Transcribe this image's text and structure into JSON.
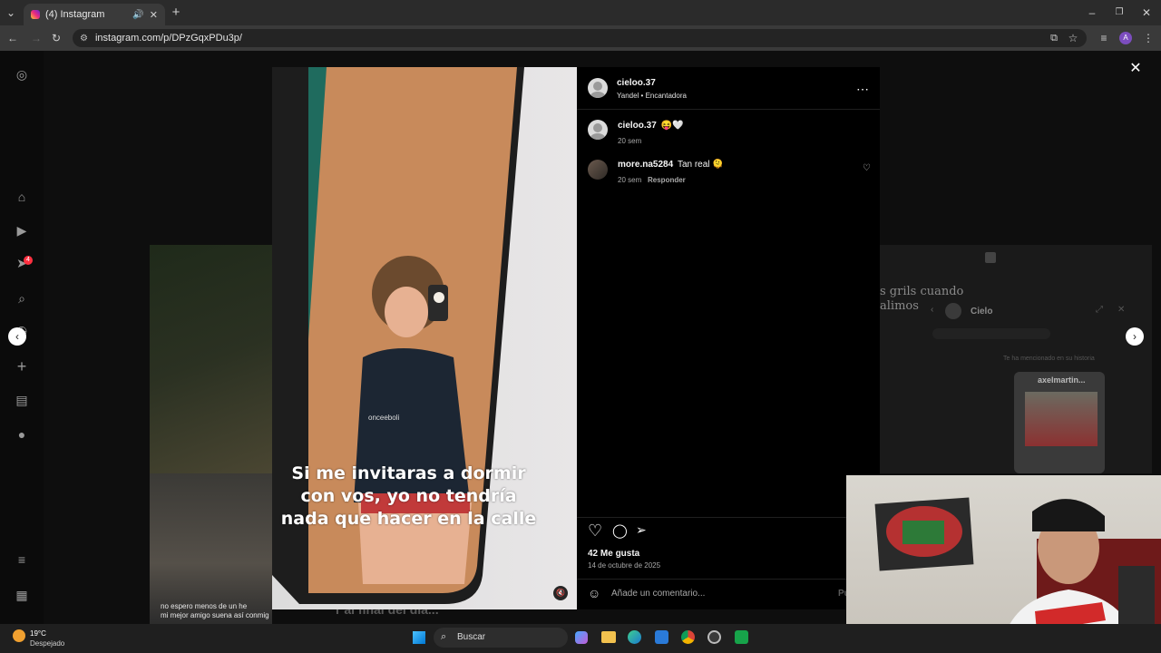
{
  "browser": {
    "tab_title": "(4) Instagram",
    "url": "instagram.com/p/DPzGqxPDu3p/",
    "profile_initial": "A"
  },
  "sidebar": {
    "notifications_badge": "4"
  },
  "post": {
    "author": "cieloo.37",
    "audio": "Yandel • Encantadora",
    "caption_overlay": "Si me invitaras a dormir con vos, yo no tendría nada que hacer en la calle",
    "shirt_text": "onceeboli",
    "comments": [
      {
        "user": "cieloo.37",
        "text": "😝🤍",
        "time": "20 sem",
        "reply": ""
      },
      {
        "user": "more.na5284",
        "text": "Tan real 🫠",
        "time": "20 sem",
        "reply": "Responder"
      }
    ],
    "likes": "42 Me gusta",
    "date": "14 de octubre de 2025",
    "comment_placeholder": "Añade un comentario...",
    "publish_partial": "Pu"
  },
  "background": {
    "right_card_title": "s grils cuando\nalimos",
    "right_card_user": "Cielo",
    "right_card_mention": "Te ha mencionado en su historia",
    "right_card_story_user": "axelmartin...",
    "left_bottom_text": "no espero menos de un he\nmi mejor amigo suena así conmig",
    "bottom_center_text": "r al final del día..."
  },
  "taskbar": {
    "weather_temp": "19°C",
    "weather_desc": "Despejado",
    "search_label": "Buscar"
  }
}
